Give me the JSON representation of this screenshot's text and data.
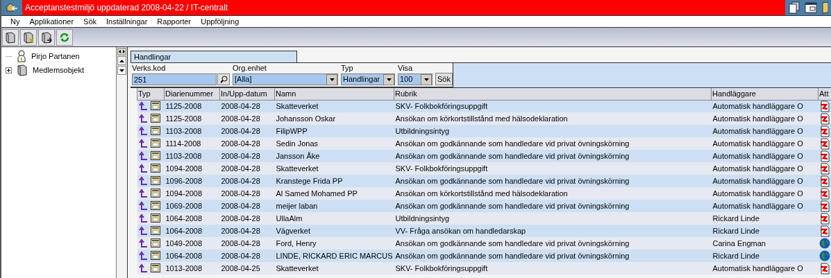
{
  "window": {
    "title": "Acceptanstestmiljö uppdaterad 2008-04-22 / IT-centralt"
  },
  "menu": [
    "Ny",
    "Applikationer",
    "Sök",
    "Inställningar",
    "Rapporter",
    "Uppföljning"
  ],
  "toolbar": [
    {
      "kind": "folder"
    },
    {
      "kind": "folder-x"
    },
    {
      "kind": "folder-arrow"
    },
    {
      "kind": "refresh"
    }
  ],
  "tree": [
    {
      "label": "Pirjo Partanen",
      "kind": "person",
      "expandable": false
    },
    {
      "label": "Medlemsobjekt",
      "kind": "folder",
      "expandable": true
    }
  ],
  "tabs": [
    {
      "label": "Handlingar",
      "selected": true
    }
  ],
  "filters": {
    "verks_kod": {
      "label": "Verks.kod",
      "value": "251"
    },
    "org_enhet": {
      "label": "Org.enhet",
      "value": "[Alla]"
    },
    "typ": {
      "label": "Typ",
      "value": "Handlingar"
    },
    "visa": {
      "label": "Visa",
      "value": "100"
    },
    "search_button": "Sök"
  },
  "table": {
    "columns": [
      "Typ",
      "Diarienummer",
      "In/Upp-datum",
      "Namn",
      "Rubrik",
      "Handläggare",
      "Att"
    ],
    "rows": [
      {
        "diarienummer": "1125-2008",
        "datum": "2008-04-28",
        "namn": "Skatteverket",
        "rubrik": "SKV- Folkbokföringsuppgift",
        "handlaggare": "Automatisk handläggare O",
        "kind": "document"
      },
      {
        "diarienummer": "1125-2008",
        "datum": "2008-04-28",
        "namn": "Johansson Oskar",
        "rubrik": "Ansökan om körkortstillstånd med hälsodeklaration",
        "handlaggare": "Automatisk handläggare O",
        "kind": "document"
      },
      {
        "diarienummer": "1103-2008",
        "datum": "2008-04-28",
        "namn": "FilipWPP",
        "rubrik": "Utbildningsintyg",
        "handlaggare": "Automatisk handläggare O",
        "kind": "document"
      },
      {
        "diarienummer": "1114-2008",
        "datum": "2008-04-28",
        "namn": "Sedin Jonas",
        "rubrik": "Ansökan om godkännande som handledare vid privat övningskörning",
        "handlaggare": "Automatisk handläggare O",
        "kind": "document"
      },
      {
        "diarienummer": "1103-2008",
        "datum": "2008-04-28",
        "namn": "Jansson Åke",
        "rubrik": "Ansökan om godkännande som handledare vid privat övningskörning",
        "handlaggare": "Automatisk handläggare O",
        "kind": "document"
      },
      {
        "diarienummer": "1094-2008",
        "datum": "2008-04-28",
        "namn": "Skatteverket",
        "rubrik": "SKV- Folkbokföringsuppgift",
        "handlaggare": "Automatisk handläggare O",
        "kind": "document"
      },
      {
        "diarienummer": "1096-2008",
        "datum": "2008-04-28",
        "namn": "Kranstege Frida PP",
        "rubrik": "Ansökan om godkännande som handledare vid privat övningskörning",
        "handlaggare": "Automatisk handläggare O",
        "kind": "document"
      },
      {
        "diarienummer": "1094-2008",
        "datum": "2008-04-28",
        "namn": "Al Samed Mohamed PP",
        "rubrik": "Ansökan om körkortstillstånd med hälsodeklaration",
        "handlaggare": "Automatisk handläggare O",
        "kind": "document"
      },
      {
        "diarienummer": "1069-2008",
        "datum": "2008-04-28",
        "namn": "meijer laban",
        "rubrik": "Ansökan om godkännande som handledare vid privat övningskörning",
        "handlaggare": "Automatisk handläggare O",
        "kind": "document"
      },
      {
        "diarienummer": "1064-2008",
        "datum": "2008-04-28",
        "namn": "UllaAlm",
        "rubrik": "Utbildningsintyg",
        "handlaggare": "Rickard Linde",
        "kind": "document"
      },
      {
        "diarienummer": "1064-2008",
        "datum": "2008-04-28",
        "namn": "Vägverket",
        "rubrik": "VV- Fråga ansökan om handledarskap",
        "handlaggare": "Rickard Linde",
        "kind": "document"
      },
      {
        "diarienummer": "1049-2008",
        "datum": "2008-04-28",
        "namn": "Ford, Henry",
        "rubrik": "Ansökan om godkännande som handledare vid privat övningskörning",
        "handlaggare": "Carina Engman",
        "kind": "globe"
      },
      {
        "diarienummer": "1064-2008",
        "datum": "2008-04-28",
        "namn": "LINDE, RICKARD ERIC MARCUS",
        "rubrik": "Ansökan om godkännande som handledare vid privat övningskörning",
        "handlaggare": "Rickard Linde",
        "kind": "globe"
      },
      {
        "diarienummer": "1013-2008",
        "datum": "2008-04-25",
        "namn": "Skatteverket",
        "rubrik": "SKV- Folkbokföringsuppgift",
        "handlaggare": "Automatisk handläggare O",
        "kind": "document"
      }
    ]
  }
}
